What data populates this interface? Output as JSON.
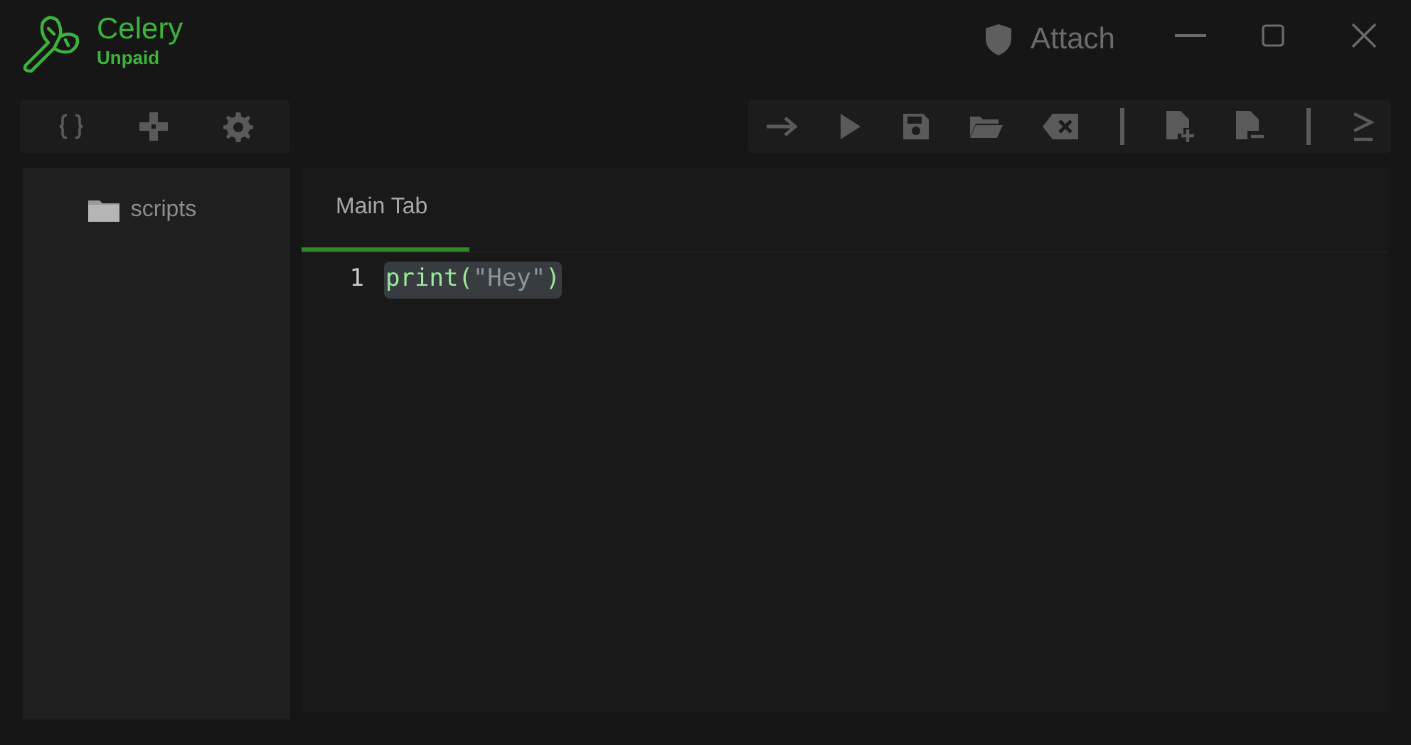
{
  "app": {
    "name": "Celery",
    "plan": "Unpaid"
  },
  "attach": {
    "label": "Attach"
  },
  "sidebar_tools": [
    {
      "kind": "braces"
    },
    {
      "kind": "gamepad"
    },
    {
      "kind": "gear"
    }
  ],
  "toolbar": [
    {
      "kind": "arrow"
    },
    {
      "kind": "play"
    },
    {
      "kind": "save"
    },
    {
      "kind": "folder"
    },
    {
      "kind": "clear"
    },
    {
      "kind": "separator"
    },
    {
      "kind": "file-add"
    },
    {
      "kind": "file-remove"
    },
    {
      "kind": "separator"
    },
    {
      "kind": "console"
    }
  ],
  "explorer": [
    {
      "label": "scripts"
    }
  ],
  "tabs": [
    {
      "label": "Main Tab",
      "selected": true
    }
  ],
  "code_lines": [
    {
      "number": "1",
      "selected": true,
      "tokens": [
        {
          "text": "print",
          "kind": "function"
        },
        {
          "text": "(",
          "kind": "punct"
        },
        {
          "text": "\"Hey\"",
          "kind": "string"
        },
        {
          "text": ")",
          "kind": "punct"
        }
      ]
    }
  ]
}
